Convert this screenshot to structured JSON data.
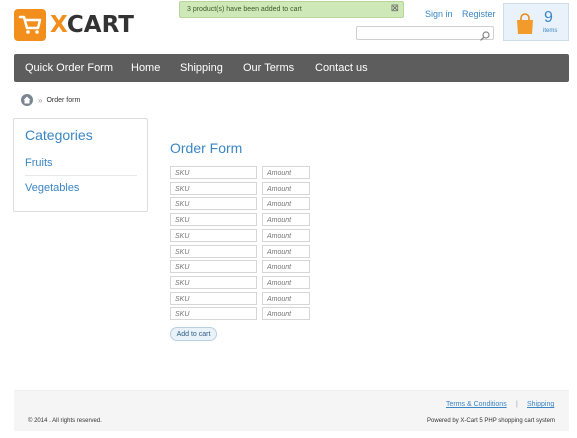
{
  "header": {
    "logo_text": "XCART",
    "notice": "3 product(s) have been added to cart",
    "notice_close": "⊠",
    "sign_in": "Sign in",
    "register": "Register",
    "search_placeholder": "",
    "cart": {
      "count": "9",
      "items_label": "items"
    }
  },
  "nav": {
    "items": [
      {
        "label": "Quick Order Form"
      },
      {
        "label": "Home"
      },
      {
        "label": "Shipping"
      },
      {
        "label": "Our Terms"
      },
      {
        "label": "Contact us"
      }
    ]
  },
  "breadcrumb": {
    "separator": "»",
    "current": "Order form"
  },
  "sidebar": {
    "title": "Categories",
    "items": [
      {
        "label": "Fruits"
      },
      {
        "label": "Vegetables"
      }
    ]
  },
  "form": {
    "title": "Order Form",
    "sku_placeholder": "SKU",
    "amount_placeholder": "Amount",
    "row_count": 10,
    "submit_label": "Add to cart"
  },
  "footer": {
    "links": [
      {
        "label": "Terms & Conditions"
      },
      {
        "label": "Shipping"
      }
    ],
    "separator": "|",
    "copyright": "© 2014 . All rights reserved.",
    "powered_by": "Powered by X-Cart 5 PHP shopping cart system"
  },
  "colors": {
    "accent": "#3a86c4",
    "brand_orange": "#f28f1c",
    "nav_bg": "#5d5d5d",
    "notice_bg": "#cfe8b8"
  },
  "icons": [
    "cart-logo-icon",
    "close-icon",
    "search-icon",
    "shopping-bag-icon",
    "home-icon"
  ]
}
